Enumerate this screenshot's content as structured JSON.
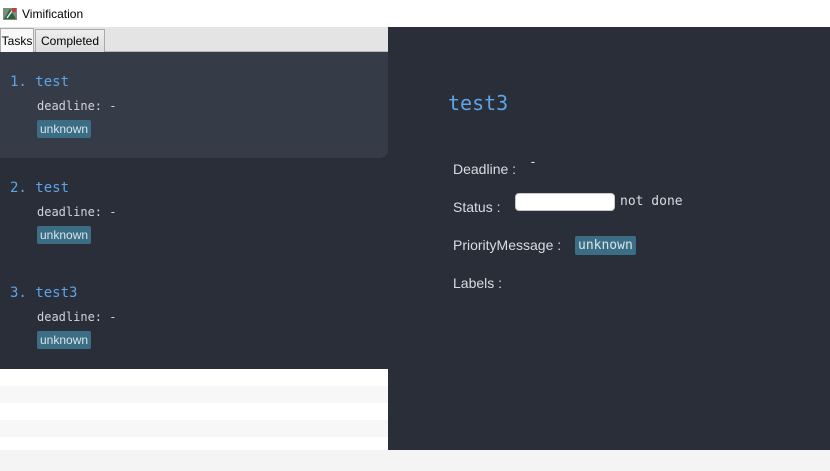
{
  "window": {
    "title": "Vimification",
    "icon": "app-leaf-icon"
  },
  "tabs": [
    {
      "label": "Tasks",
      "selected": true
    },
    {
      "label": "Completed",
      "selected": false
    }
  ],
  "tasks": [
    {
      "title": "1. test",
      "deadline": "deadline: -",
      "badge": "unknown",
      "selected": true
    },
    {
      "title": "2. test",
      "deadline": "deadline: -",
      "badge": "unknown",
      "selected": false
    },
    {
      "title": "3. test3",
      "deadline": "deadline: -",
      "badge": "unknown",
      "selected": false
    }
  ],
  "detail": {
    "title": "test3",
    "deadline_label": "Deadline :",
    "deadline_value": "-",
    "status_label": "Status :",
    "status_value": "not done",
    "priority_label": "PriorityMessage :",
    "priority_value": "unknown",
    "labels_label": "Labels :"
  },
  "colors": {
    "panel_bg": "#2a2e38",
    "selected_card_bg": "#363b48",
    "title_accent": "#5ea4e8",
    "badge_bg": "#3b6e84"
  }
}
